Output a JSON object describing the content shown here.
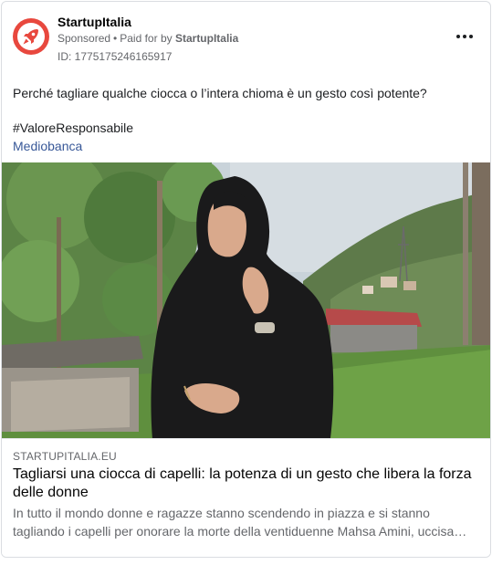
{
  "post": {
    "page_name": "StartupItalia",
    "sponsored_label": "Sponsored",
    "separator": "•",
    "paid_for_prefix": "Paid for by",
    "paid_for_name": "StartupItalia",
    "ad_id": "ID: 1775175246165917",
    "text": "Perché tagliare qualche ciocca o l’intera chioma è un gesto così potente?",
    "hashtag": "#ValoreResponsabile",
    "mention": "Mediobanca"
  },
  "link_preview": {
    "domain": "STARTUPITALIA.EU",
    "title": "Tagliarsi una ciocca di capelli: la potenza di un gesto che libera la forza delle donne",
    "description": "In tutto il mondo donne e ragazze stanno scendendo in piazza e si stanno tagliando i capelli per onorare la morte della ventiduenne Mahsa Amini, uccisa…"
  },
  "icons": {
    "avatar": "rocket-logo-icon",
    "more": "more-options-icon"
  },
  "colors": {
    "brand": "#e8483e",
    "link": "#385898",
    "muted": "#65676b"
  }
}
